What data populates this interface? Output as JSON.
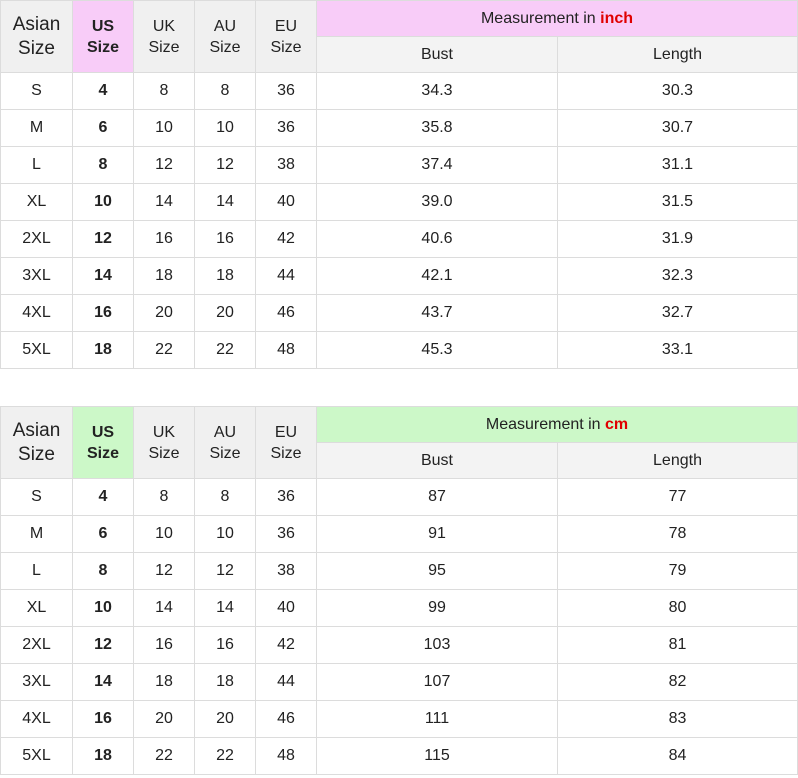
{
  "headers": {
    "asian": [
      "Asian",
      "Size"
    ],
    "us": [
      "US",
      "Size"
    ],
    "uk": [
      "UK",
      "Size"
    ],
    "au": [
      "AU",
      "Size"
    ],
    "eu": [
      "EU",
      "Size"
    ],
    "bust": "Bust",
    "length": "Length"
  },
  "colors": {
    "inch_header_bg": "#f8ccf8",
    "cm_header_bg": "#ccf8c8",
    "unit_highlight": "#e00000"
  },
  "tables": [
    {
      "measurement_prefix": "Measurement in ",
      "unit": "inch",
      "rows": [
        {
          "asian": "S",
          "us": "4",
          "uk": "8",
          "au": "8",
          "eu": "36",
          "bust": "34.3",
          "length": "30.3"
        },
        {
          "asian": "M",
          "us": "6",
          "uk": "10",
          "au": "10",
          "eu": "36",
          "bust": "35.8",
          "length": "30.7"
        },
        {
          "asian": "L",
          "us": "8",
          "uk": "12",
          "au": "12",
          "eu": "38",
          "bust": "37.4",
          "length": "31.1"
        },
        {
          "asian": "XL",
          "us": "10",
          "uk": "14",
          "au": "14",
          "eu": "40",
          "bust": "39.0",
          "length": "31.5"
        },
        {
          "asian": "2XL",
          "us": "12",
          "uk": "16",
          "au": "16",
          "eu": "42",
          "bust": "40.6",
          "length": "31.9"
        },
        {
          "asian": "3XL",
          "us": "14",
          "uk": "18",
          "au": "18",
          "eu": "44",
          "bust": "42.1",
          "length": "32.3"
        },
        {
          "asian": "4XL",
          "us": "16",
          "uk": "20",
          "au": "20",
          "eu": "46",
          "bust": "43.7",
          "length": "32.7"
        },
        {
          "asian": "5XL",
          "us": "18",
          "uk": "22",
          "au": "22",
          "eu": "48",
          "bust": "45.3",
          "length": "33.1"
        }
      ]
    },
    {
      "measurement_prefix": "Measurement in ",
      "unit": "cm",
      "rows": [
        {
          "asian": "S",
          "us": "4",
          "uk": "8",
          "au": "8",
          "eu": "36",
          "bust": "87",
          "length": "77"
        },
        {
          "asian": "M",
          "us": "6",
          "uk": "10",
          "au": "10",
          "eu": "36",
          "bust": "91",
          "length": "78"
        },
        {
          "asian": "L",
          "us": "8",
          "uk": "12",
          "au": "12",
          "eu": "38",
          "bust": "95",
          "length": "79"
        },
        {
          "asian": "XL",
          "us": "10",
          "uk": "14",
          "au": "14",
          "eu": "40",
          "bust": "99",
          "length": "80"
        },
        {
          "asian": "2XL",
          "us": "12",
          "uk": "16",
          "au": "16",
          "eu": "42",
          "bust": "103",
          "length": "81"
        },
        {
          "asian": "3XL",
          "us": "14",
          "uk": "18",
          "au": "18",
          "eu": "44",
          "bust": "107",
          "length": "82"
        },
        {
          "asian": "4XL",
          "us": "16",
          "uk": "20",
          "au": "20",
          "eu": "46",
          "bust": "111",
          "length": "83"
        },
        {
          "asian": "5XL",
          "us": "18",
          "uk": "22",
          "au": "22",
          "eu": "48",
          "bust": "115",
          "length": "84"
        }
      ]
    }
  ]
}
